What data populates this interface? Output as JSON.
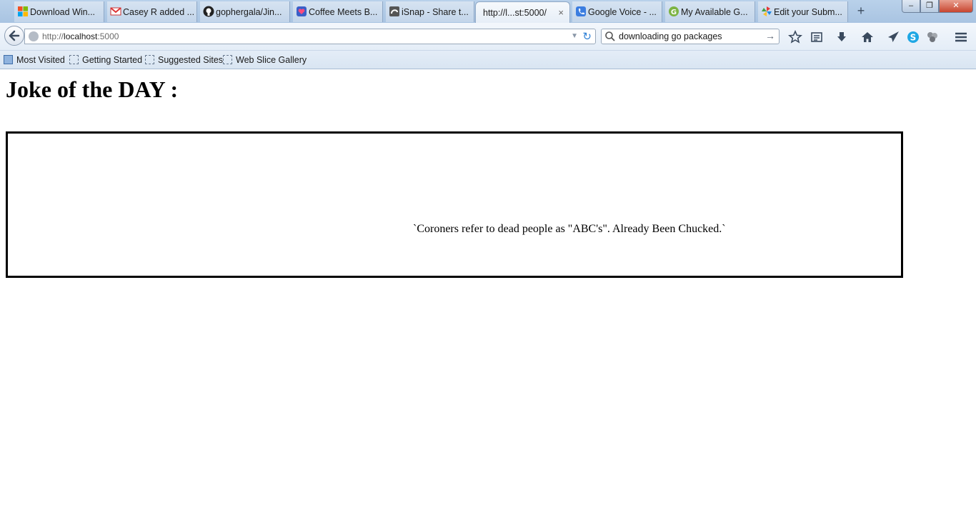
{
  "browser": {
    "tabs": [
      {
        "label": "Download Win...",
        "icon": "windows-logo-icon"
      },
      {
        "label": "Casey R added ...",
        "icon": "gmail-icon"
      },
      {
        "label": "gophergala/Jin...",
        "icon": "github-icon"
      },
      {
        "label": "Coffee Meets B...",
        "icon": "heart-app-icon"
      },
      {
        "label": "iSnap - Share t...",
        "icon": "isnap-icon"
      },
      {
        "label": "http://l...st:5000/",
        "icon": "",
        "active": true
      },
      {
        "label": "Google Voice - ...",
        "icon": "phone-icon"
      },
      {
        "label": "My Available G...",
        "icon": "g-logo-icon"
      },
      {
        "label": "Edit your Subm...",
        "icon": "pinwheel-icon"
      }
    ],
    "new_tab_label": "+",
    "tab_close_glyph": "×",
    "window_controls": {
      "minimize": "‒",
      "maximize": "❐",
      "close": "✕"
    },
    "url": {
      "scheme": "http://",
      "host": "localhost",
      "port": ":5000"
    },
    "search_query": "downloading go packages",
    "toolbar_icons": [
      "star-icon",
      "reading-list-icon",
      "download-icon",
      "home-icon",
      "send-icon",
      "skype-icon",
      "extension-icon",
      "menu-icon"
    ],
    "bookmarks": [
      {
        "label": "Most Visited"
      },
      {
        "label": "Getting Started"
      },
      {
        "label": "Suggested Sites"
      },
      {
        "label": "Web Slice Gallery"
      }
    ]
  },
  "page": {
    "heading": "Joke of the DAY :",
    "joke": "`Coroners refer to dead people as \"ABC's\". Already Been Chucked.`"
  },
  "colors": {
    "tab_strip": "#b9d1ea",
    "reload_accent": "#2e80d6",
    "joke_border": "#000000"
  }
}
